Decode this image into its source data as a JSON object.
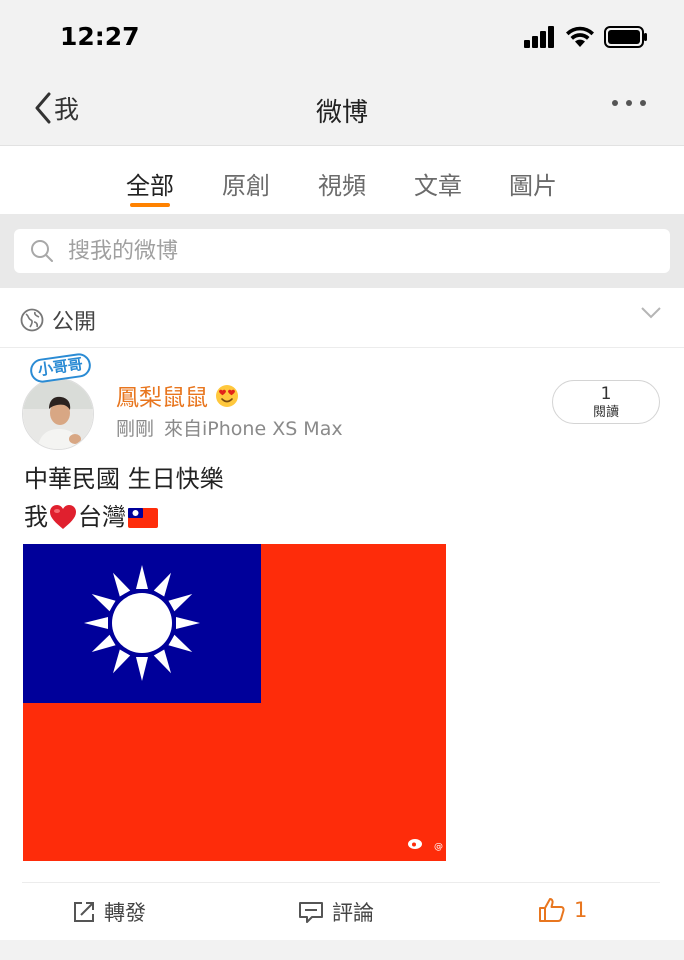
{
  "status_bar": {
    "time": "12:27"
  },
  "nav": {
    "back_label": "我",
    "title": "微博"
  },
  "tabs": [
    {
      "label": "全部",
      "active": true
    },
    {
      "label": "原創",
      "active": false
    },
    {
      "label": "視頻",
      "active": false
    },
    {
      "label": "文章",
      "active": false
    },
    {
      "label": "圖片",
      "active": false
    }
  ],
  "search": {
    "placeholder": "搜我的微博"
  },
  "filter": {
    "label": "公開"
  },
  "post": {
    "avatar_sticker": "小哥哥",
    "username": "鳳梨鼠鼠",
    "time": "剛剛",
    "source": "來自iPhone XS Max",
    "read_count": "1",
    "read_label": "閱讀",
    "text_line1": "中華民國 生日快樂",
    "text_line2_a": "我",
    "text_line2_b": "台灣",
    "image_watermark": "@",
    "actions": {
      "repost": "轉發",
      "comment": "評論",
      "like_count": "1"
    }
  },
  "colors": {
    "accent": "#ff8200",
    "username": "#e8761f",
    "flag_red": "#fe2c0a",
    "flag_blue": "#00009a"
  }
}
